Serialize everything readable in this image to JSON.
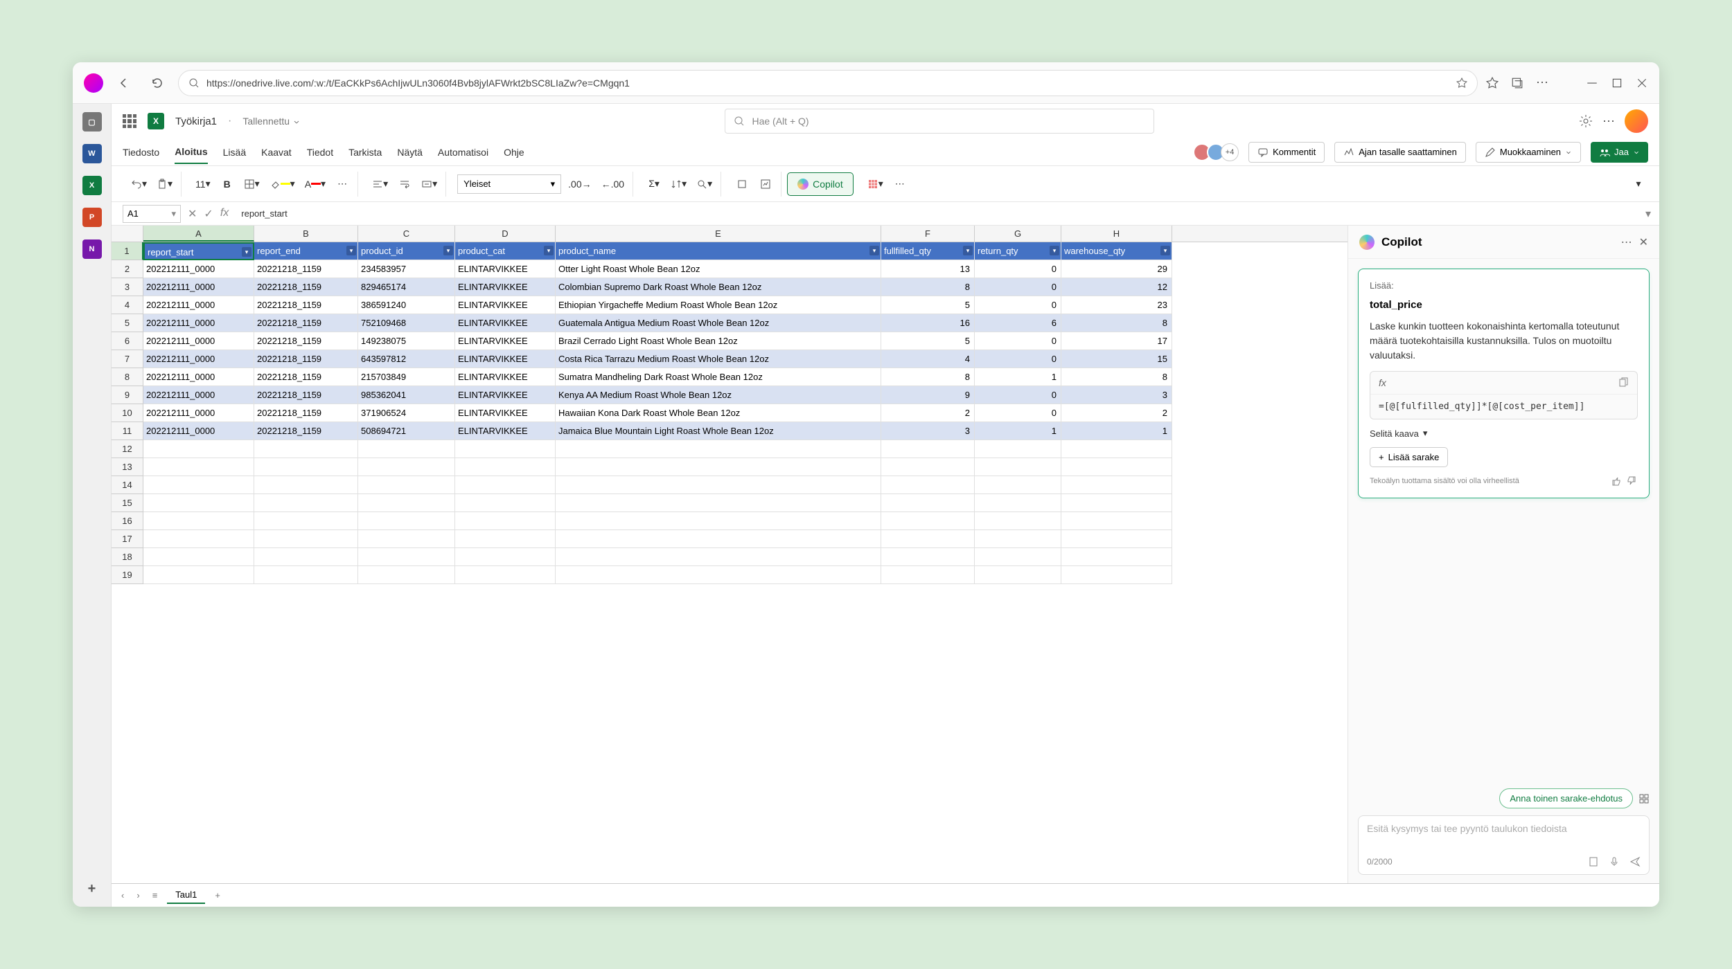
{
  "titlebar": {
    "url": "https://onedrive.live.com/:w:/t/EaCKkPs6AchIjwULn3060f4Bvb8jylAFWrkt2bSC8LIaZw?e=CMgqn1"
  },
  "appbar": {
    "doc_title": "Työkirja1",
    "doc_saved": "Tallennettu",
    "search_placeholder": "Hae (Alt + Q)"
  },
  "tabs": {
    "items": [
      "Tiedosto",
      "Aloitus",
      "Lisää",
      "Kaavat",
      "Tiedot",
      "Tarkista",
      "Näytä",
      "Automatisoi",
      "Ohje"
    ],
    "active": 1,
    "comments": "Kommentit",
    "catchup": "Ajan tasalle saattaminen",
    "editing": "Muokkaaminen",
    "share": "Jaa",
    "presence_more": "+4"
  },
  "ribbon": {
    "fontsize": "11",
    "format": "Yleiset",
    "copilot": "Copilot"
  },
  "formula": {
    "namebox": "A1",
    "value": "report_start"
  },
  "grid": {
    "cols": [
      "A",
      "B",
      "C",
      "D",
      "E",
      "F",
      "G",
      "H"
    ],
    "headers": [
      "report_start",
      "report_end",
      "product_id",
      "product_cat",
      "product_name",
      "fullfilled_qty",
      "return_qty",
      "warehouse_qty"
    ],
    "rows": [
      [
        "202212111_0000",
        "20221218_1159",
        "234583957",
        "ELINTARVIKKEE",
        "Otter Light Roast Whole Bean 12oz",
        "13",
        "0",
        "29"
      ],
      [
        "202212111_0000",
        "20221218_1159",
        "829465174",
        "ELINTARVIKKEE",
        "Colombian Supremo Dark Roast Whole Bean 12oz",
        "8",
        "0",
        "12"
      ],
      [
        "202212111_0000",
        "20221218_1159",
        "386591240",
        "ELINTARVIKKEE",
        "Ethiopian Yirgacheffe Medium Roast Whole Bean 12oz",
        "5",
        "0",
        "23"
      ],
      [
        "202212111_0000",
        "20221218_1159",
        "752109468",
        "ELINTARVIKKEE",
        "Guatemala Antigua Medium Roast Whole Bean 12oz",
        "16",
        "6",
        "8"
      ],
      [
        "202212111_0000",
        "20221218_1159",
        "149238075",
        "ELINTARVIKKEE",
        "Brazil Cerrado Light Roast Whole Bean 12oz",
        "5",
        "0",
        "17"
      ],
      [
        "202212111_0000",
        "20221218_1159",
        "643597812",
        "ELINTARVIKKEE",
        "Costa Rica Tarrazu Medium Roast Whole Bean 12oz",
        "4",
        "0",
        "15"
      ],
      [
        "202212111_0000",
        "20221218_1159",
        "215703849",
        "ELINTARVIKKEE",
        "Sumatra Mandheling Dark Roast Whole Bean 12oz",
        "8",
        "1",
        "8"
      ],
      [
        "202212111_0000",
        "20221218_1159",
        "985362041",
        "ELINTARVIKKEE",
        "Kenya AA Medium Roast Whole Bean 12oz",
        "9",
        "0",
        "3"
      ],
      [
        "202212111_0000",
        "20221218_1159",
        "371906524",
        "ELINTARVIKKEE",
        "Hawaiian Kona Dark Roast Whole Bean 12oz",
        "2",
        "0",
        "2"
      ],
      [
        "202212111_0000",
        "20221218_1159",
        "508694721",
        "ELINTARVIKKEE",
        "Jamaica Blue Mountain Light Roast Whole Bean 12oz",
        "3",
        "1",
        "1"
      ]
    ],
    "empty_rows": [
      12,
      13,
      14,
      15,
      16,
      17,
      18,
      19
    ]
  },
  "sheets": {
    "tab1": "Taul1"
  },
  "copilot": {
    "title": "Copilot",
    "label_add": "Lisää:",
    "col_name": "total_price",
    "desc": "Laske kunkin tuotteen kokonaishinta kertomalla toteutunut määrä tuotekohtaisilla kustannuksilla. Tulos on muotoiltu valuutaksi.",
    "formula": "=[@[fulfilled_qty]]*[@[cost_per_item]]",
    "explain": "Selitä kaava",
    "add_col": "Lisää sarake",
    "disclaimer": "Tekoälyn tuottama sisältö voi olla virheellistä",
    "suggest": "Anna toinen sarake-ehdotus",
    "input_placeholder": "Esitä kysymys tai tee pyyntö taulukon tiedoista",
    "counter": "0/2000"
  }
}
